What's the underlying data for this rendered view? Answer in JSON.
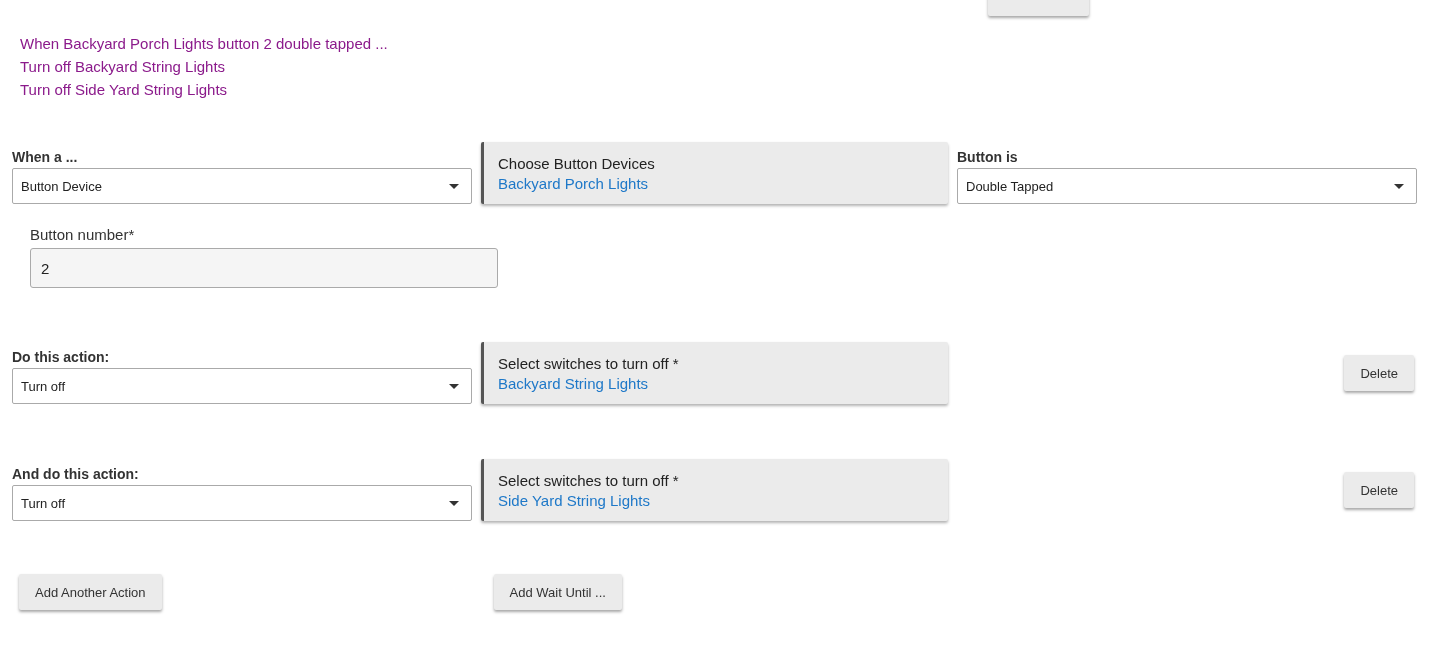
{
  "summary": {
    "lines": [
      "When Backyard Porch Lights button 2 double tapped ...",
      "Turn off Backyard String Lights",
      "Turn off Side Yard String Lights"
    ]
  },
  "trigger": {
    "label": "When a ...",
    "value": "Button Device",
    "picker": {
      "title": "Choose Button Devices",
      "value": "Backyard Porch Lights"
    },
    "condition": {
      "label": "Button is",
      "value": "Double Tapped"
    },
    "number": {
      "label": "Button number*",
      "value": "2"
    }
  },
  "actions": [
    {
      "label": "Do this action:",
      "value": "Turn off",
      "picker": {
        "title": "Select switches to turn off *",
        "value": "Backyard String Lights"
      },
      "button": "Delete"
    },
    {
      "label": "And do this action:",
      "value": "Turn off",
      "picker": {
        "title": "Select switches to turn off *",
        "value": "Side Yard String Lights"
      },
      "button": "Delete"
    }
  ],
  "footer_buttons": [
    "Add Another Action",
    "Add Wait Until ..."
  ]
}
